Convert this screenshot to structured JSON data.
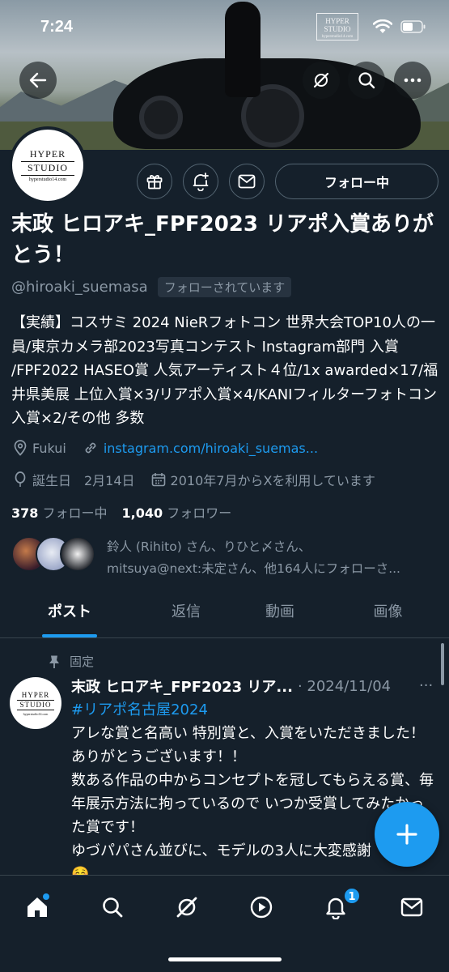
{
  "status_bar": {
    "time": "7:24"
  },
  "banner": {
    "logo_line1": "HYPER",
    "logo_line2": "STUDIO",
    "logo_line3": "hyperstudio14.com"
  },
  "profile": {
    "avatar_logo": {
      "line1": "HYPER",
      "line2": "STUDIO",
      "line3": "hyperstudio14.com"
    },
    "follow_button_label": "フォロー中",
    "display_name": "末政 ヒロアキ_FPF2023 リアポ入賞ありがとう！",
    "handle": "@hiroaki_suemasa",
    "follows_you_label": "フォローされています",
    "bio": "【実績】コスサミ 2024 NieRフォトコン 世界大会TOP10人の一員/東京カメラ部2023写真コンテスト Instagram部門 入賞 /FPF2022 HASEO賞 人気アーティスト４位/1x awarded×17/福井県美展 上位入賞×3/リアポ入賞×4/KANIフィルターフォトコン入賞×2/その他 多数",
    "location": "Fukui",
    "website": "instagram.com/hiroaki_suemas...",
    "birthday": "誕生日　2月14日",
    "joined": "2010年7月からXを利用しています",
    "following_count": "378",
    "following_label": "フォロー中",
    "followers_count": "1,040",
    "followers_label": "フォロワー",
    "known_followers_line1": "鈴人 (Rihito) さん、りひと〆さん、",
    "known_followers_line2": "mitsuya@next:未定さん、他164人にフォローさ..."
  },
  "tabs": [
    {
      "label": "ポスト"
    },
    {
      "label": "返信"
    },
    {
      "label": "動画"
    },
    {
      "label": "画像"
    }
  ],
  "post": {
    "pinned_label": "固定",
    "author": "末政 ヒロアキ_FPF2023 リア...",
    "date": "· 2024/11/04",
    "more": "···",
    "hashtag": "#リアポ名古屋2024",
    "lines": [
      "アレな賞と名高い 特別賞と、入賞をいただきました！ありがとうございます！！",
      "数ある作品の中からコンセプトを冠してもらえる賞、毎年展示方法に拘っているので いつか受賞してみたかった賞です！",
      "ゆづパパさん並びに、モデルの3人に大変感謝",
      "☺️"
    ]
  },
  "bottom_nav": {
    "notification_badge": "1"
  },
  "colors": {
    "background": "#15202b",
    "accent": "#1d9bf0",
    "secondary_text": "#8b98a5",
    "border": "#38444d"
  }
}
